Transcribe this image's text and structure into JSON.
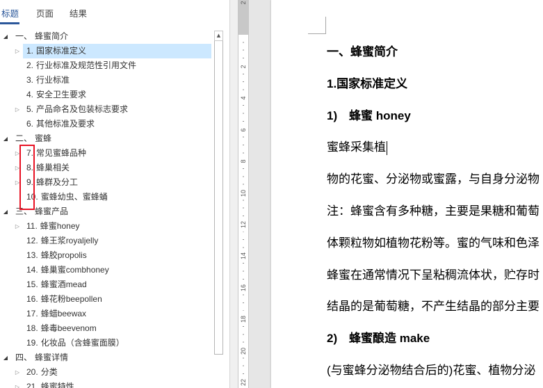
{
  "nav": {
    "tabs": [
      {
        "label": "标题",
        "active": true
      },
      {
        "label": "页面",
        "active": false
      },
      {
        "label": "结果",
        "active": false
      }
    ],
    "tree": [
      {
        "level": 1,
        "num": "一、",
        "title": "蜂蜜简介",
        "icon": "expanded-triangle-icon"
      },
      {
        "level": 2,
        "num": "1.",
        "title": "国家标准定义",
        "icon": "collapsed-triangle-icon",
        "selected": true
      },
      {
        "level": 2,
        "num": "2.",
        "title": "行业标准及规范性引用文件"
      },
      {
        "level": 2,
        "num": "3.",
        "title": "行业标准"
      },
      {
        "level": 2,
        "num": "4.",
        "title": "安全卫生要求"
      },
      {
        "level": 2,
        "num": "5.",
        "title": "产品命名及包装标志要求",
        "icon": "collapsed-triangle-icon"
      },
      {
        "level": 2,
        "num": "6.",
        "title": "其他标准及要求"
      },
      {
        "level": 1,
        "num": "二、",
        "title": "蜜蜂",
        "icon": "expanded-triangle-icon"
      },
      {
        "level": 2,
        "num": "7.",
        "title": "常见蜜蜂品种",
        "icon": "collapsed-triangle-icon"
      },
      {
        "level": 2,
        "num": "8.",
        "title": "蜂巢相关",
        "icon": "collapsed-triangle-icon"
      },
      {
        "level": 2,
        "num": "9.",
        "title": "蜂群及分工",
        "icon": "collapsed-triangle-icon"
      },
      {
        "level": 2,
        "num": "10.",
        "title": "蜜蜂幼虫、蜜蜂蛹"
      },
      {
        "level": 1,
        "num": "三、",
        "title": "蜂蜜产品",
        "icon": "expanded-triangle-icon"
      },
      {
        "level": 2,
        "num": "11.",
        "title": "蜂蜜honey",
        "icon": "collapsed-triangle-icon"
      },
      {
        "level": 2,
        "num": "12.",
        "title": "蜂王浆royaljelly"
      },
      {
        "level": 2,
        "num": "13.",
        "title": "蜂胶propolis"
      },
      {
        "level": 2,
        "num": "14.",
        "title": "蜂巢蜜combhoney"
      },
      {
        "level": 2,
        "num": "15.",
        "title": "蜂蜜酒mead"
      },
      {
        "level": 2,
        "num": "16.",
        "title": "蜂花粉beepollen"
      },
      {
        "level": 2,
        "num": "17.",
        "title": "蜂蜡beewax"
      },
      {
        "level": 2,
        "num": "18.",
        "title": "蜂毒beevenom"
      },
      {
        "level": 2,
        "num": "19.",
        "title": "化妆品（含蜂蜜面膜）"
      },
      {
        "level": 1,
        "num": "四、",
        "title": "蜂蜜详情",
        "icon": "expanded-triangle-icon"
      },
      {
        "level": 2,
        "num": "20.",
        "title": "分类",
        "icon": "collapsed-triangle-icon"
      },
      {
        "level": 2,
        "num": "21.",
        "title": "蜂蜜特性",
        "icon": "collapsed-triangle-icon"
      }
    ],
    "scroll_up_icon": "scroll-up-arrow-icon"
  },
  "ruler": {
    "labels": [
      "2",
      "2",
      "4",
      "6",
      "8",
      "10",
      "12",
      "14",
      "16",
      "18",
      "20",
      "22"
    ]
  },
  "document": {
    "lines": [
      {
        "text": "一、蜂蜜简介",
        "bold": true
      },
      {
        "text": "1.国家标准定义",
        "bold": true
      },
      {
        "num": "1)",
        "text": "蜂蜜 honey",
        "bold": true
      },
      {
        "text": "蜜蜂采集植",
        "cursor": true
      },
      {
        "text": "物的花蜜、分泌物或蜜露，与自身分泌物"
      },
      {
        "text": "注：蜂蜜含有多种糖，主要是果糖和葡萄"
      },
      {
        "text": "体颗粒物如植物花粉等。蜜的气味和色泽"
      },
      {
        "text": "蜂蜜在通常情况下呈粘稠流体状，贮存时"
      },
      {
        "text": "结晶的是葡萄糖，不产生结晶的部分主要"
      },
      {
        "num": "2)",
        "text": "蜂蜜酿造 make",
        "bold": true
      },
      {
        "text": "(与蜜蜂分泌物结合后的)花蜜、植物分泌"
      }
    ]
  },
  "colors": {
    "accent": "#2b579a",
    "selection": "#cce8ff",
    "annotation": "#e81123"
  }
}
